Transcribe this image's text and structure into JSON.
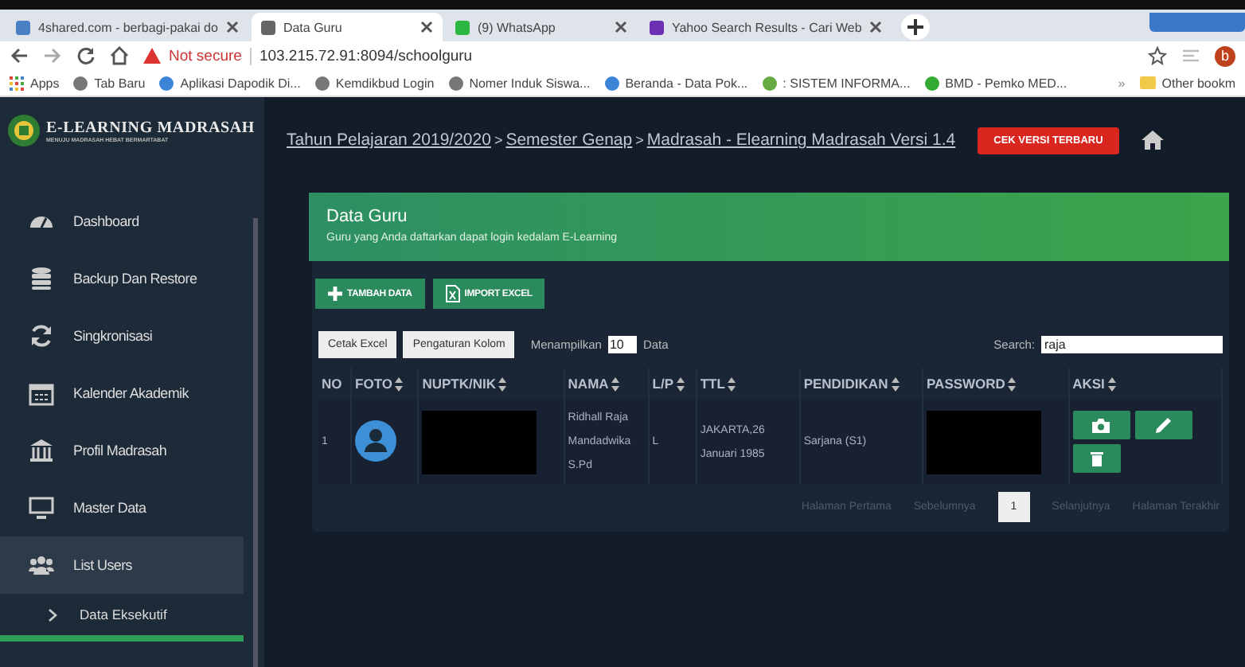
{
  "browser": {
    "tabs": [
      {
        "title": "4shared.com - berbagi-pakai do",
        "selected": false
      },
      {
        "title": "Data Guru",
        "selected": true
      },
      {
        "title": "(9) WhatsApp",
        "selected": false
      },
      {
        "title": "Yahoo Search Results - Cari Web",
        "selected": false
      }
    ],
    "address": {
      "security": "Not secure",
      "url": "103.215.72.91:8094/schoolguru"
    },
    "bookmarks": [
      "Apps",
      "Tab Baru",
      "Aplikasi Dapodik Di...",
      "Kemdikbud Login",
      "Nomer Induk Siswa...",
      "Beranda - Data Pok...",
      ": SISTEM INFORMA...",
      "BMD - Pemko MED..."
    ],
    "more_bookmarks": "»",
    "other_bookmarks": "Other bookm",
    "profile_initial": "b"
  },
  "sidebar": {
    "brand": "E-LEARNING MADRASAH",
    "tagline": "MENUJU MADRASAH HEBAT BERMARTABAT",
    "items": [
      {
        "label": "Dashboard",
        "selected": false
      },
      {
        "label": "Backup Dan Restore",
        "selected": false
      },
      {
        "label": "Singkronisasi",
        "selected": false
      },
      {
        "label": "Kalender Akademik",
        "selected": false
      },
      {
        "label": "Profil Madrasah",
        "selected": false
      },
      {
        "label": "Master Data",
        "selected": false
      },
      {
        "label": "List Users",
        "selected": true,
        "children": [
          {
            "label": "Data Eksekutif",
            "selected": false
          }
        ]
      }
    ]
  },
  "header": {
    "breadcrumb": [
      "Tahun Pelajaran 2019/2020",
      "Semester Genap",
      "Madrasah - Elearning Madrasah Versi 1.4"
    ],
    "separator": ">",
    "update_button": "CEK VERSI TERBARU"
  },
  "panel": {
    "title": "Data Guru",
    "subtitle": "Guru yang Anda daftarkan dapat login kedalam E-Learning",
    "actions": [
      "TAMBAH DATA",
      "IMPORT EXCEL"
    ],
    "tools": [
      "Cetak Excel",
      "Pengaturan Kolom"
    ],
    "show_label": "Menampilkan",
    "page_size": "10",
    "show_suffix": "Data",
    "search_label": "Search:",
    "search_value": "raja",
    "table": {
      "columns": [
        "NO",
        "FOTO",
        "NUPTK/NIK",
        "NAMA",
        "L/P",
        "TTL",
        "PENDIDIKAN",
        "PASSWORD",
        "AKSI"
      ],
      "rows": [
        {
          "no": "1",
          "nuptk_redacted": true,
          "nama": "Ridhall Raja Mandadwika S.Pd",
          "lp": "L",
          "ttl": "JAKARTA,26 Januari 1985",
          "pendidikan": "Sarjana (S1)",
          "password_redacted": true
        }
      ]
    },
    "pagination": [
      {
        "label": "Halaman Pertama",
        "selected": false
      },
      {
        "label": "Sebelumnya",
        "selected": false
      },
      {
        "label": "1",
        "selected": true
      },
      {
        "label": "Selanjutnya",
        "selected": false
      },
      {
        "label": "Halaman Terakhir",
        "selected": false
      }
    ]
  }
}
